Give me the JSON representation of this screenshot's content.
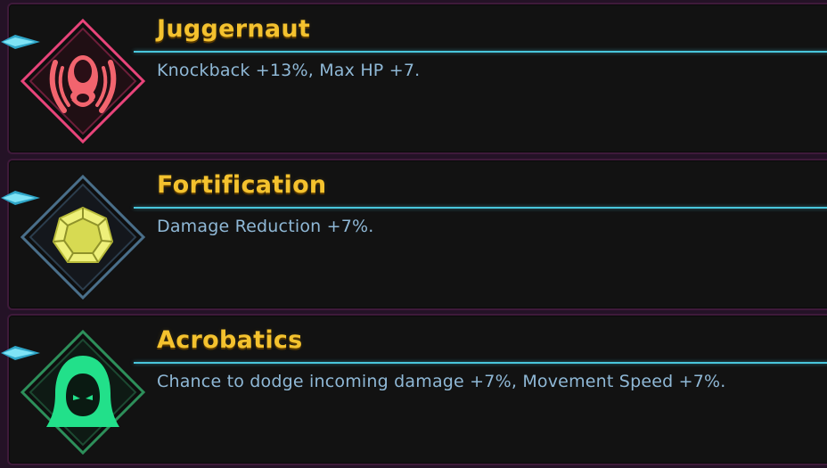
{
  "upgrades": [
    {
      "title": "Juggernaut",
      "description": "Knockback +13%, Max HP +7.",
      "icon": "egg-shield-icon",
      "icon_color": "#f2646e",
      "frame_color": "#e8447a"
    },
    {
      "title": "Fortification",
      "description": "Damage Reduction +7%.",
      "icon": "gem-icon",
      "icon_color": "#eef07a",
      "frame_color": "#4a6f8a"
    },
    {
      "title": "Acrobatics",
      "description": "Chance to dodge incoming damage +7%, Movement Speed +7%.",
      "icon": "hooded-figure-icon",
      "icon_color": "#22e08a",
      "frame_color": "#2d8f5a"
    }
  ],
  "colors": {
    "title": "#f4c22e",
    "description": "#8fb8d6",
    "divider": "#49c6dc",
    "card_background": "#121212",
    "card_border": "#3e1a3a"
  }
}
